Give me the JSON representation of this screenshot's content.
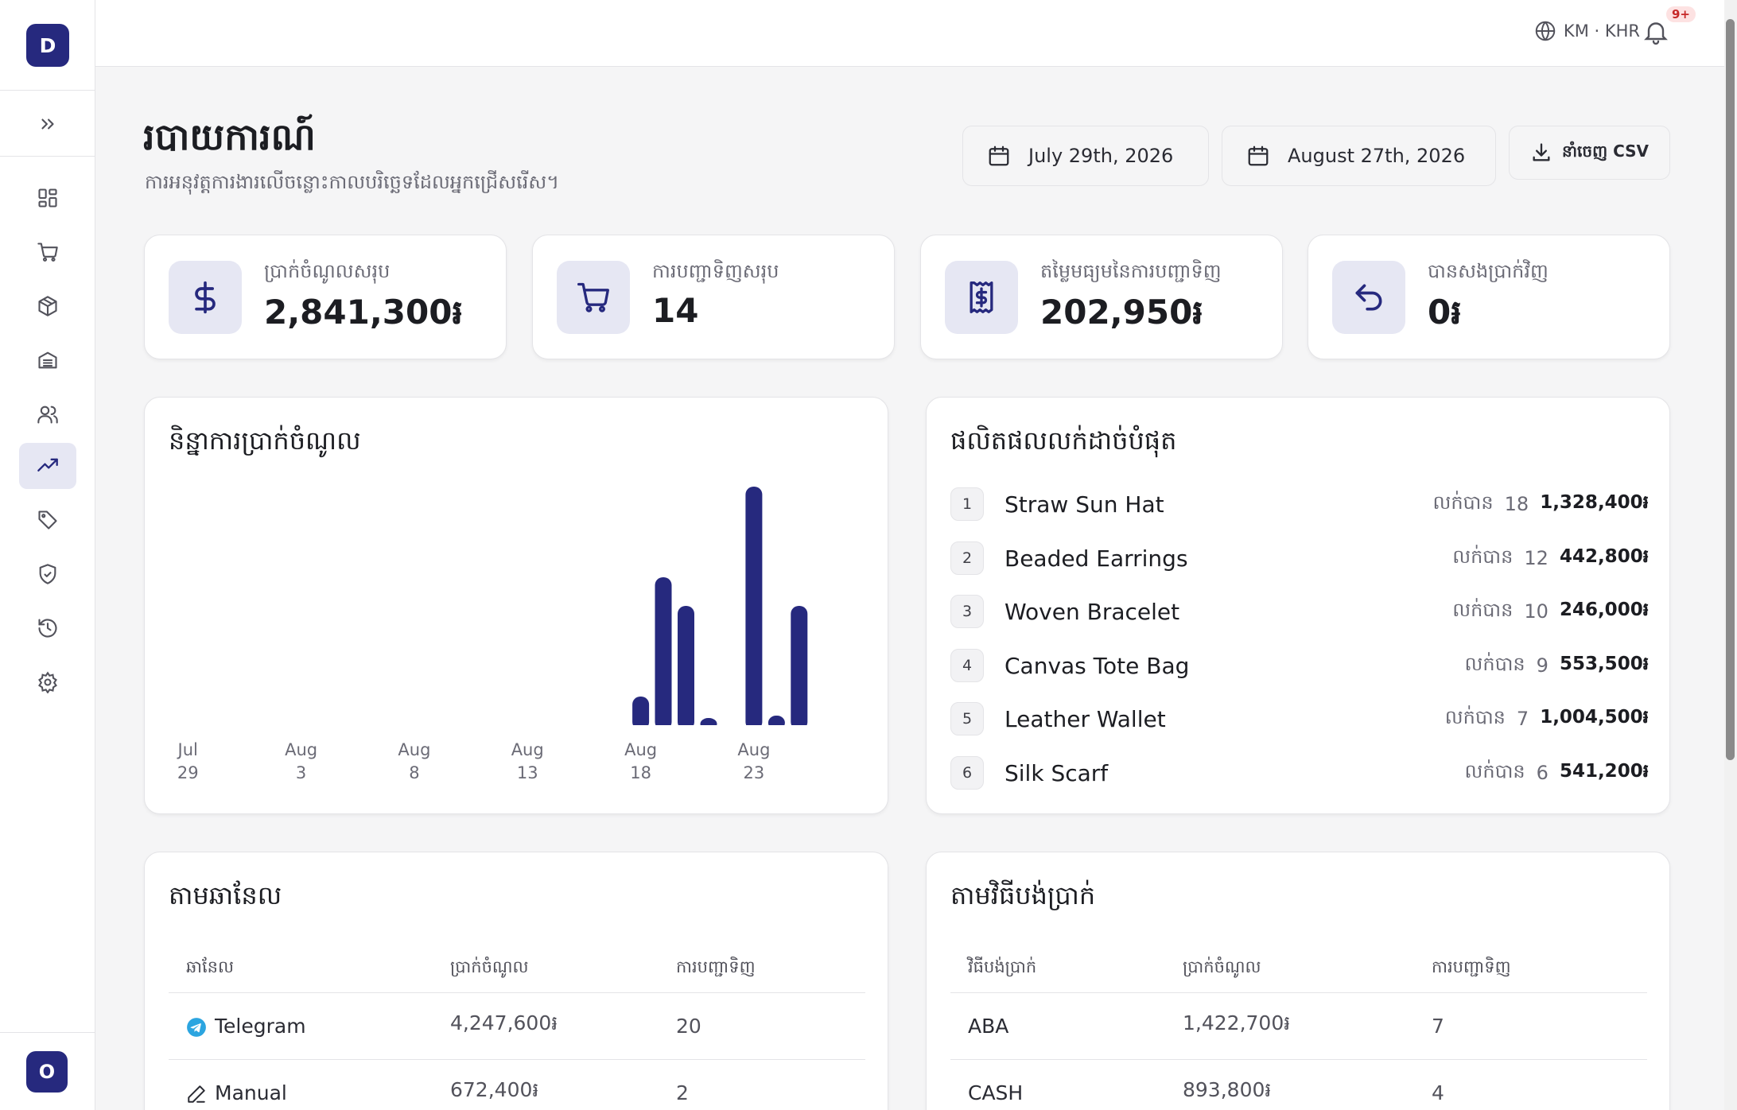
{
  "sidebar": {
    "logo_letter": "D",
    "user_initial": "O",
    "items": [
      {
        "icon": "dashboard-icon",
        "active": false
      },
      {
        "icon": "cart-icon",
        "active": false
      },
      {
        "icon": "package-icon",
        "active": false
      },
      {
        "icon": "inventory-icon",
        "active": false
      },
      {
        "icon": "customers-icon",
        "active": false
      },
      {
        "icon": "analytics-icon",
        "active": true
      },
      {
        "icon": "tag-icon",
        "active": false
      },
      {
        "icon": "shield-icon",
        "active": false
      },
      {
        "icon": "history-icon",
        "active": false
      },
      {
        "icon": "settings-icon",
        "active": false
      }
    ]
  },
  "topbar": {
    "lang_label": "KM · KHR",
    "notif_badge": "9+"
  },
  "header": {
    "title": "របាយការណ៍",
    "subtitle": "ការអនុវត្តការងារលើចន្លោះកាលបរិច្ឆេទដែលអ្នកជ្រើសរើស។",
    "date_from": "July 29th, 2026",
    "date_to": "August 27th, 2026",
    "export_label": "នាំចេញ CSV"
  },
  "stats": [
    {
      "label": "ប្រាក់ចំណូលសរុប",
      "value": "2,841,300៛",
      "icon": "dollar-icon"
    },
    {
      "label": "ការបញ្ជាទិញសរុប",
      "value": "14",
      "icon": "cart-icon"
    },
    {
      "label": "តម្លៃមធ្យមនៃការបញ្ជាទិញ",
      "value": "202,950៛",
      "icon": "receipt-icon"
    },
    {
      "label": "បានសងប្រាក់វិញ",
      "value": "0៛",
      "icon": "refund-icon"
    }
  ],
  "revenue_chart": {
    "title": "និន្នាការប្រាក់ចំណូល"
  },
  "chart_data": {
    "type": "bar",
    "categories": [
      "Jul 29",
      "Jul 30",
      "Jul 31",
      "Aug 1",
      "Aug 2",
      "Aug 3",
      "Aug 4",
      "Aug 5",
      "Aug 6",
      "Aug 7",
      "Aug 8",
      "Aug 9",
      "Aug 10",
      "Aug 11",
      "Aug 12",
      "Aug 13",
      "Aug 14",
      "Aug 15",
      "Aug 16",
      "Aug 17",
      "Aug 18",
      "Aug 19",
      "Aug 20",
      "Aug 21",
      "Aug 22",
      "Aug 23",
      "Aug 24",
      "Aug 25",
      "Aug 26",
      "Aug 27"
    ],
    "values": [
      0,
      0,
      0,
      0,
      0,
      0,
      0,
      0,
      0,
      0,
      0,
      0,
      0,
      0,
      0,
      0,
      0,
      0,
      0,
      0,
      12,
      62,
      50,
      3,
      0,
      100,
      4,
      50,
      0,
      0
    ],
    "tick_labels": [
      {
        "month": "Jul",
        "day": "29",
        "index": 0
      },
      {
        "month": "Aug",
        "day": "3",
        "index": 5
      },
      {
        "month": "Aug",
        "day": "8",
        "index": 10
      },
      {
        "month": "Aug",
        "day": "13",
        "index": 15
      },
      {
        "month": "Aug",
        "day": "18",
        "index": 20
      },
      {
        "month": "Aug",
        "day": "23",
        "index": 25
      }
    ],
    "bar_color": "#26297e",
    "grid": false,
    "ylim": [
      0,
      100
    ]
  },
  "top_products": {
    "title": "ផលិតផលលក់ដាច់បំផុត",
    "sold_prefix": "លក់បាន",
    "items": [
      {
        "rank": "1",
        "name": "Straw Sun Hat",
        "sold": "18",
        "revenue": "1,328,400៛"
      },
      {
        "rank": "2",
        "name": "Beaded Earrings",
        "sold": "12",
        "revenue": "442,800៛"
      },
      {
        "rank": "3",
        "name": "Woven Bracelet",
        "sold": "10",
        "revenue": "246,000៛"
      },
      {
        "rank": "4",
        "name": "Canvas Tote Bag",
        "sold": "9",
        "revenue": "553,500៛"
      },
      {
        "rank": "5",
        "name": "Leather Wallet",
        "sold": "7",
        "revenue": "1,004,500៛"
      },
      {
        "rank": "6",
        "name": "Silk Scarf",
        "sold": "6",
        "revenue": "541,200៛"
      }
    ]
  },
  "by_channel": {
    "title": "តាមឆានែល",
    "headers": [
      "ឆានែល",
      "ប្រាក់ចំណូល",
      "ការបញ្ជាទិញ"
    ],
    "rows": [
      {
        "icon": "telegram-icon",
        "name": "Telegram",
        "revenue": "4,247,600៛",
        "orders": "20"
      },
      {
        "icon": "pen-icon",
        "name": "Manual",
        "revenue": "672,400៛",
        "orders": "2"
      }
    ]
  },
  "by_payment": {
    "title": "តាមវិធីបង់ប្រាក់",
    "headers": [
      "វិធីបង់ប្រាក់",
      "ប្រាក់ចំណូល",
      "ការបញ្ជាទិញ"
    ],
    "rows": [
      {
        "name": "ABA",
        "revenue": "1,422,700៛",
        "orders": "7"
      },
      {
        "name": "CASH",
        "revenue": "893,800៛",
        "orders": "4"
      }
    ]
  }
}
